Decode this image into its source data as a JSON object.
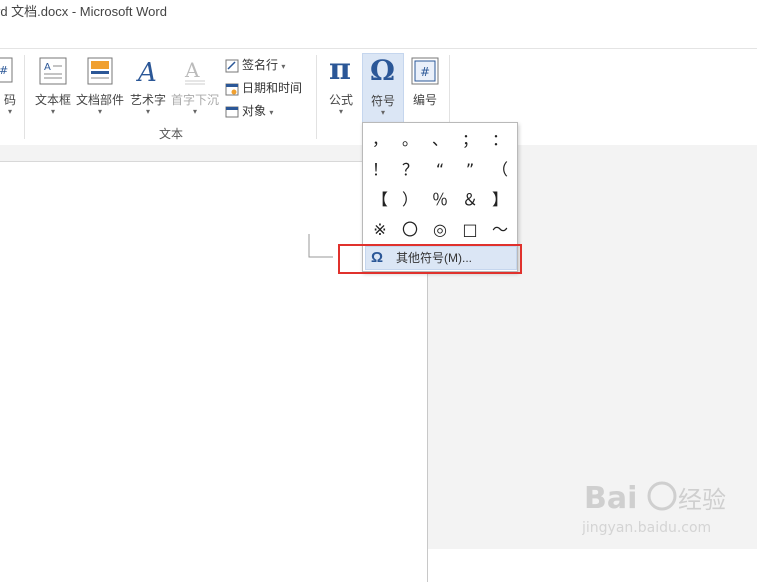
{
  "window": {
    "title": "rd 文档.docx - Microsoft Word"
  },
  "ribbon": {
    "partial_left_label": "码",
    "buttons": {
      "textbox": "文本框",
      "quickparts": "文档部件",
      "wordart": "艺术字",
      "dropcap": "首字下沉",
      "signature": "签名行",
      "datetime": "日期和时间",
      "object": "对象",
      "equation": "公式",
      "symbol": "符号",
      "number": "编号"
    },
    "group_text_label": "文本"
  },
  "symbol_menu": {
    "symbols": [
      "，",
      "。",
      "、",
      "；",
      "：",
      "！",
      "？",
      "“",
      "”",
      "（",
      "【",
      "）",
      "％",
      "＆",
      "】",
      "※",
      "〇",
      "◎",
      "□",
      "～"
    ],
    "more_label": "其他符号(M)..."
  },
  "watermark": {
    "brand": "Baidu",
    "cn": "经验",
    "url": "jingyan.baidu.com"
  },
  "colors": {
    "accent": "#2b5797",
    "highlight": "#e0312c",
    "menu_hover": "#dbe6f5"
  }
}
